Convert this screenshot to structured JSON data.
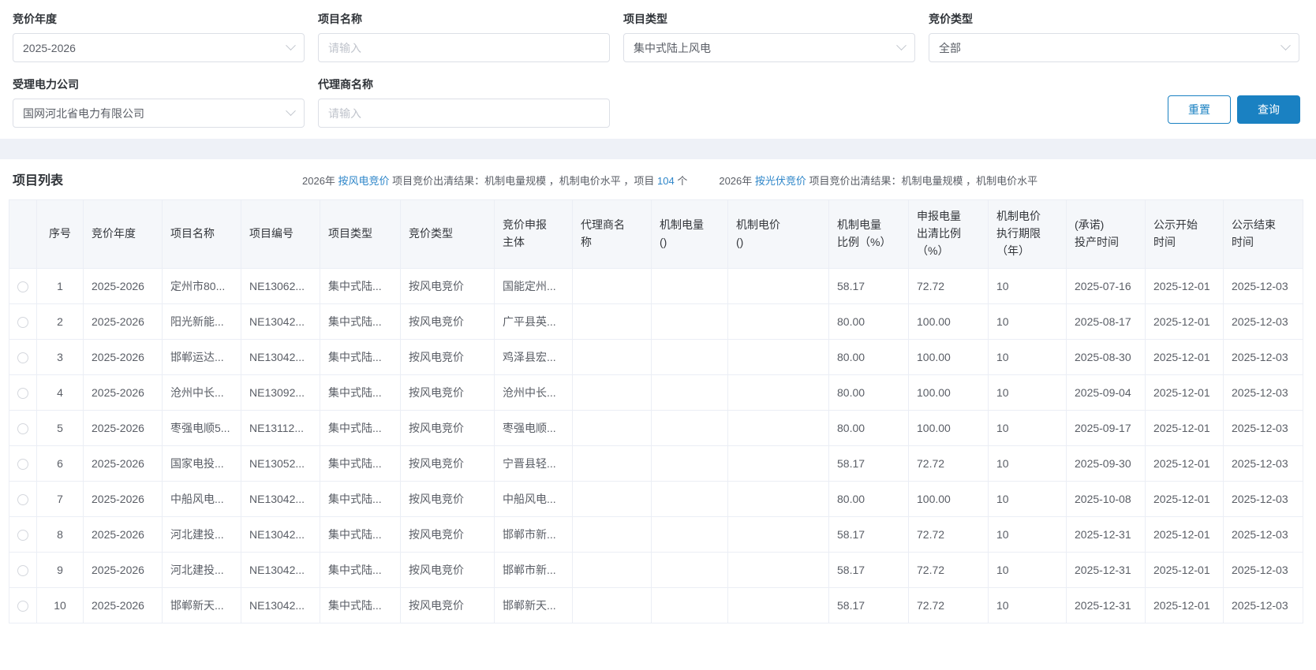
{
  "filters": {
    "fields": [
      {
        "label": "竞价年度",
        "type": "select",
        "value": "2025-2026"
      },
      {
        "label": "项目名称",
        "type": "input",
        "placeholder": "请输入"
      },
      {
        "label": "项目类型",
        "type": "select",
        "value": "集中式陆上风电"
      },
      {
        "label": "竞价类型",
        "type": "select",
        "value": "全部"
      },
      {
        "label": "受理电力公司",
        "type": "select",
        "value": "国网河北省电力有限公司"
      },
      {
        "label": "代理商名称",
        "type": "input",
        "placeholder": "请输入"
      }
    ],
    "reset_label": "重置",
    "search_label": "查询"
  },
  "list": {
    "title": "项目列表",
    "notices": [
      {
        "prefix": "2026年 ",
        "link": "按风电竞价",
        "mid": " 项目竞价出清结果：机制电量规模 ，机制电价水平 ，项目 ",
        "count": "104",
        "suffix": " 个"
      },
      {
        "prefix": "2026年 ",
        "link": "按光伏竞价",
        "mid": " 项目竞价出清结果：机制电量规模 ，机制电价水平",
        "count": "",
        "suffix": ""
      }
    ]
  },
  "table": {
    "columns": [
      "",
      "序号",
      "竞价年度",
      "项目名称",
      "项目编号",
      "项目类型",
      "竞价类型",
      "竞价申报\n主体",
      "代理商名\n称",
      "机制电量\n()",
      "机制电价\n()",
      "机制电量\n比例（%）",
      "申报电量\n出清比例\n（%）",
      "机制电价\n执行期限\n（年）",
      "(承诺)\n投产时间",
      "公示开始\n时间",
      "公示结束\n时间"
    ],
    "rows": [
      [
        "1",
        "2025-2026",
        "定州市80...",
        "NE13062...",
        "集中式陆...",
        "按风电竞价",
        "国能定州...",
        "",
        "",
        "",
        "58.17",
        "72.72",
        "10",
        "2025-07-16",
        "2025-12-01",
        "2025-12-03"
      ],
      [
        "2",
        "2025-2026",
        "阳光新能...",
        "NE13042...",
        "集中式陆...",
        "按风电竞价",
        "广平县英...",
        "",
        "",
        "",
        "80.00",
        "100.00",
        "10",
        "2025-08-17",
        "2025-12-01",
        "2025-12-03"
      ],
      [
        "3",
        "2025-2026",
        "邯郸运达...",
        "NE13042...",
        "集中式陆...",
        "按风电竞价",
        "鸡泽县宏...",
        "",
        "",
        "",
        "80.00",
        "100.00",
        "10",
        "2025-08-30",
        "2025-12-01",
        "2025-12-03"
      ],
      [
        "4",
        "2025-2026",
        "沧州中长...",
        "NE13092...",
        "集中式陆...",
        "按风电竞价",
        "沧州中长...",
        "",
        "",
        "",
        "80.00",
        "100.00",
        "10",
        "2025-09-04",
        "2025-12-01",
        "2025-12-03"
      ],
      [
        "5",
        "2025-2026",
        "枣强电顺5...",
        "NE13112...",
        "集中式陆...",
        "按风电竞价",
        "枣强电顺...",
        "",
        "",
        "",
        "80.00",
        "100.00",
        "10",
        "2025-09-17",
        "2025-12-01",
        "2025-12-03"
      ],
      [
        "6",
        "2025-2026",
        "国家电投...",
        "NE13052...",
        "集中式陆...",
        "按风电竞价",
        "宁晋县轻...",
        "",
        "",
        "",
        "58.17",
        "72.72",
        "10",
        "2025-09-30",
        "2025-12-01",
        "2025-12-03"
      ],
      [
        "7",
        "2025-2026",
        "中船风电...",
        "NE13042...",
        "集中式陆...",
        "按风电竞价",
        "中船风电...",
        "",
        "",
        "",
        "80.00",
        "100.00",
        "10",
        "2025-10-08",
        "2025-12-01",
        "2025-12-03"
      ],
      [
        "8",
        "2025-2026",
        "河北建投...",
        "NE13042...",
        "集中式陆...",
        "按风电竞价",
        "邯郸市新...",
        "",
        "",
        "",
        "58.17",
        "72.72",
        "10",
        "2025-12-31",
        "2025-12-01",
        "2025-12-03"
      ],
      [
        "9",
        "2025-2026",
        "河北建投...",
        "NE13042...",
        "集中式陆...",
        "按风电竞价",
        "邯郸市新...",
        "",
        "",
        "",
        "58.17",
        "72.72",
        "10",
        "2025-12-31",
        "2025-12-01",
        "2025-12-03"
      ],
      [
        "10",
        "2025-2026",
        "邯郸新天...",
        "NE13042...",
        "集中式陆...",
        "按风电竞价",
        "邯郸新天...",
        "",
        "",
        "",
        "58.17",
        "72.72",
        "10",
        "2025-12-31",
        "2025-12-01",
        "2025-12-03"
      ]
    ]
  },
  "colors": {
    "primary_blue": "#1a81c2",
    "link_blue": "#2e86c9",
    "divider_band": "#eef1f7",
    "table_header_bg": "#f5f7fa"
  }
}
